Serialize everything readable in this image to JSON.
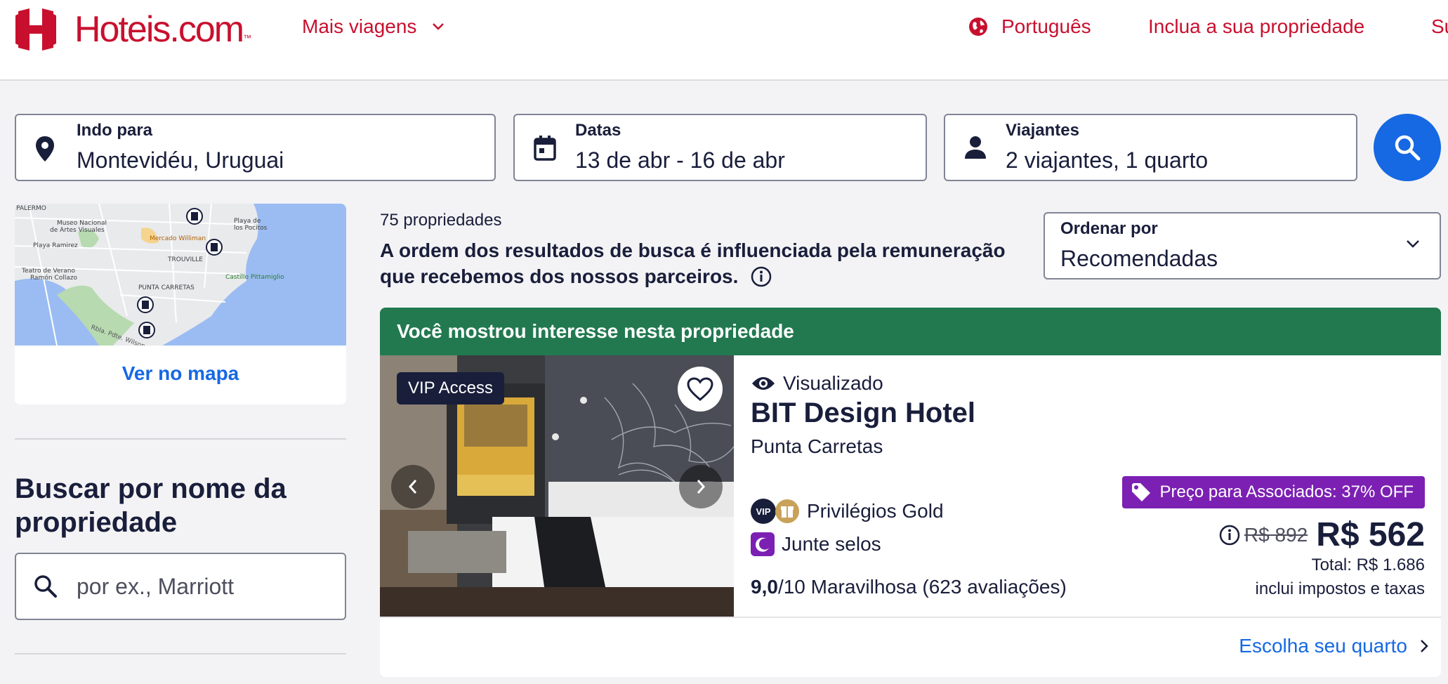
{
  "header": {
    "brand": "Hoteis.com",
    "brand_tm": "™",
    "more_trips": "Mais viagens",
    "language": "Português",
    "list_property": "Inclua a sua propriedade",
    "cut_item": "Su"
  },
  "search": {
    "destination": {
      "label": "Indo para",
      "value": "Montevidéu, Uruguai"
    },
    "dates": {
      "label": "Datas",
      "value": "13 de abr - 16 de abr"
    },
    "travelers": {
      "label": "Viajantes",
      "value": "2 viajantes, 1 quarto"
    }
  },
  "map": {
    "link": "Ver no mapa",
    "labels": [
      "PALERMO",
      "Museo Nacional de Artes Visuales",
      "Playa Ramirez",
      "Mercado Williman",
      "TROUVILLE",
      "Playa de los Pocitos",
      "Teatro de Verano Ramón Collazo",
      "PUNTA CARRETAS",
      "Castillo Pittamiglio",
      "Rbla. Pdte. Wilson"
    ]
  },
  "name_search": {
    "title": "Buscar por nome da propriedade",
    "placeholder": "por ex., Marriott"
  },
  "results": {
    "count": "75 propriedades",
    "disclaimer": "A ordem dos resultados de busca é influenciada pela remuneração que recebemos dos nossos parceiros."
  },
  "sort": {
    "label": "Ordenar por",
    "value": "Recomendadas"
  },
  "property": {
    "banner": "Você mostrou interesse nesta propriedade",
    "vip_badge": "VIP Access",
    "viewed": "Visualizado",
    "name": "BIT Design Hotel",
    "area": "Punta Carretas",
    "vip_mini": "VIP",
    "privileges": "Privilégios Gold",
    "stamps": "Junte selos",
    "rating_score": "9,0",
    "rating_rest": "/10 Maravilhosa (623 avaliações)",
    "member_tag": "Preço para Associados: 37% OFF",
    "old_price": "R$ 892",
    "price": "R$ 562",
    "total": "Total: R$ 1.686",
    "taxes": "inclui impostos e taxas",
    "cta": "Escolha seu quarto"
  },
  "colors": {
    "brand_red": "#c8102e",
    "primary_blue": "#1668e3",
    "banner_green": "#227950",
    "member_purple": "#7c20b3"
  }
}
